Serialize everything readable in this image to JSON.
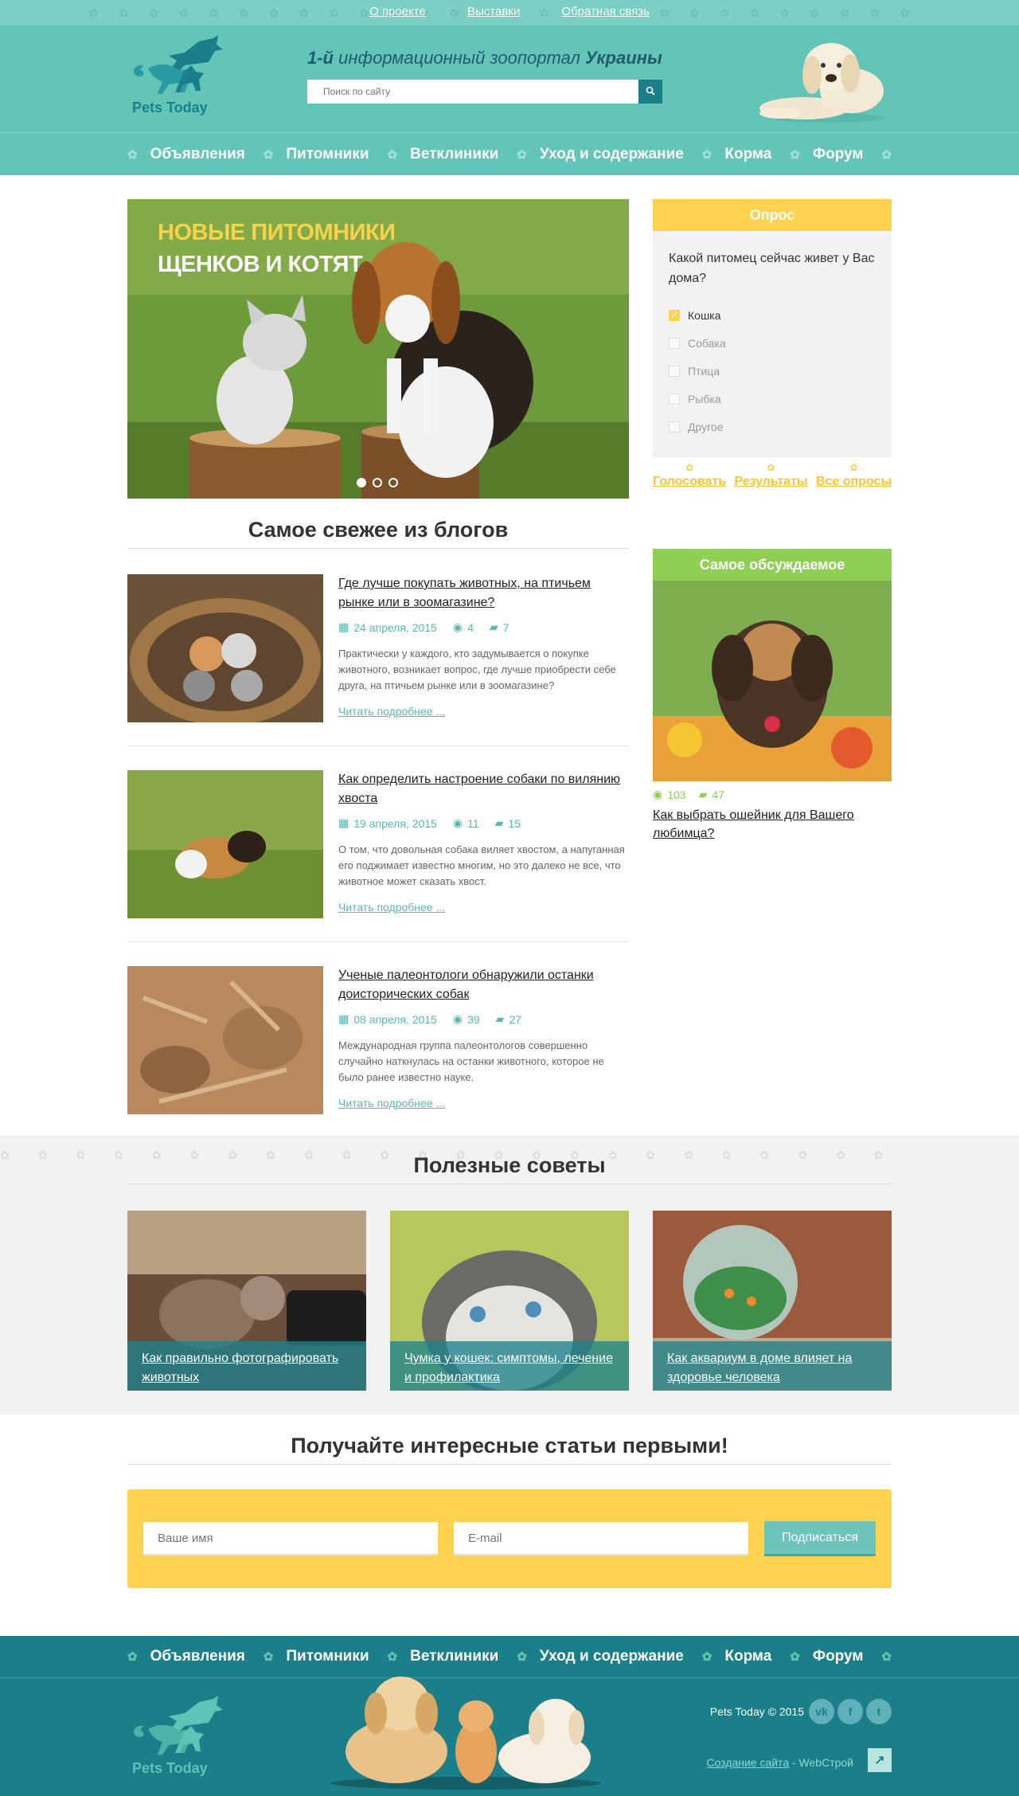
{
  "topbar": {
    "links": [
      "О проекте",
      "Выставки",
      "Обратная связь"
    ]
  },
  "header": {
    "logo_text": "Pets Today",
    "slogan_pre": "1-й",
    "slogan_mid": " информационный зоопортал ",
    "slogan_bold": "Украины",
    "search_placeholder": "Поиск по сайту"
  },
  "nav": [
    "Объявления",
    "Питомники",
    "Ветклиники",
    "Уход и содержание",
    "Корма",
    "Форум"
  ],
  "hero": {
    "line1": "Новые питомники",
    "line2": "щенков и котят"
  },
  "blogs": {
    "title": "Самое свежее из блогов",
    "more_label": "Читать подробнее ...",
    "posts": [
      {
        "title": "Где лучше покупать животных, на птичьем рынке или в зоомагазине?",
        "date": "24 апреля, 2015",
        "views": "4",
        "comments": "7",
        "text": "Практически у каждого, кто задумывается о покупке животного, возникает вопрос, где лучше приобрести себе друга, на птичьем рынке или в зоомагазине?"
      },
      {
        "title": "Как определить настроение собаки по вилянию хвоста",
        "date": "19 апреля, 2015",
        "views": "11",
        "comments": "15",
        "text": "О том, что довольная собака виляет хвостом, а напуганная его поджимает известно многим, но это далеко не все, что животное может сказать хвост."
      },
      {
        "title": "Ученые палеонтологи обнаружили останки доисторических собак",
        "date": "08 апреля, 2015",
        "views": "39",
        "comments": "27",
        "text": "Международная группа палеонтологов совершенно случайно наткнулась на останки животного, которое не было ранее известно науке."
      }
    ]
  },
  "poll": {
    "title": "Опрос",
    "question": "Какой питомец сейчас живет у Вас дома?",
    "options": [
      "Кошка",
      "Собака",
      "Птица",
      "Рыбка",
      "Другое"
    ],
    "selected_index": 0,
    "actions": [
      "Голосовать",
      "Результаты",
      "Все опросы"
    ]
  },
  "discussed": {
    "title": "Самое обсуждаемое",
    "views": "103",
    "comments": "47",
    "post_title": "Как выбрать ошейник для Вашего любимца?"
  },
  "tips": {
    "title": "Полезные советы",
    "items": [
      "Как правильно фотографировать животных",
      "Чумка у кошек: симптомы, лечение и профилактика",
      "Как аквариум в доме влияет на здоровье человека"
    ]
  },
  "subscribe": {
    "title": "Получайте интересные статьи первыми!",
    "name_placeholder": "Ваше имя",
    "email_placeholder": "E-mail",
    "button": "Подписаться"
  },
  "footer": {
    "copyright": "Pets Today © 2015",
    "social": [
      "vk-icon",
      "facebook-icon",
      "twitter-icon"
    ],
    "social_glyphs": [
      "vk",
      "f",
      "t"
    ],
    "credit_link": "Создание сайта",
    "credit_text": " - WebСтрой"
  },
  "colors": {
    "teal": "#63c4b8",
    "dark_teal": "#1b7f89",
    "yellow": "#fdd24f",
    "green": "#8ecf54"
  }
}
